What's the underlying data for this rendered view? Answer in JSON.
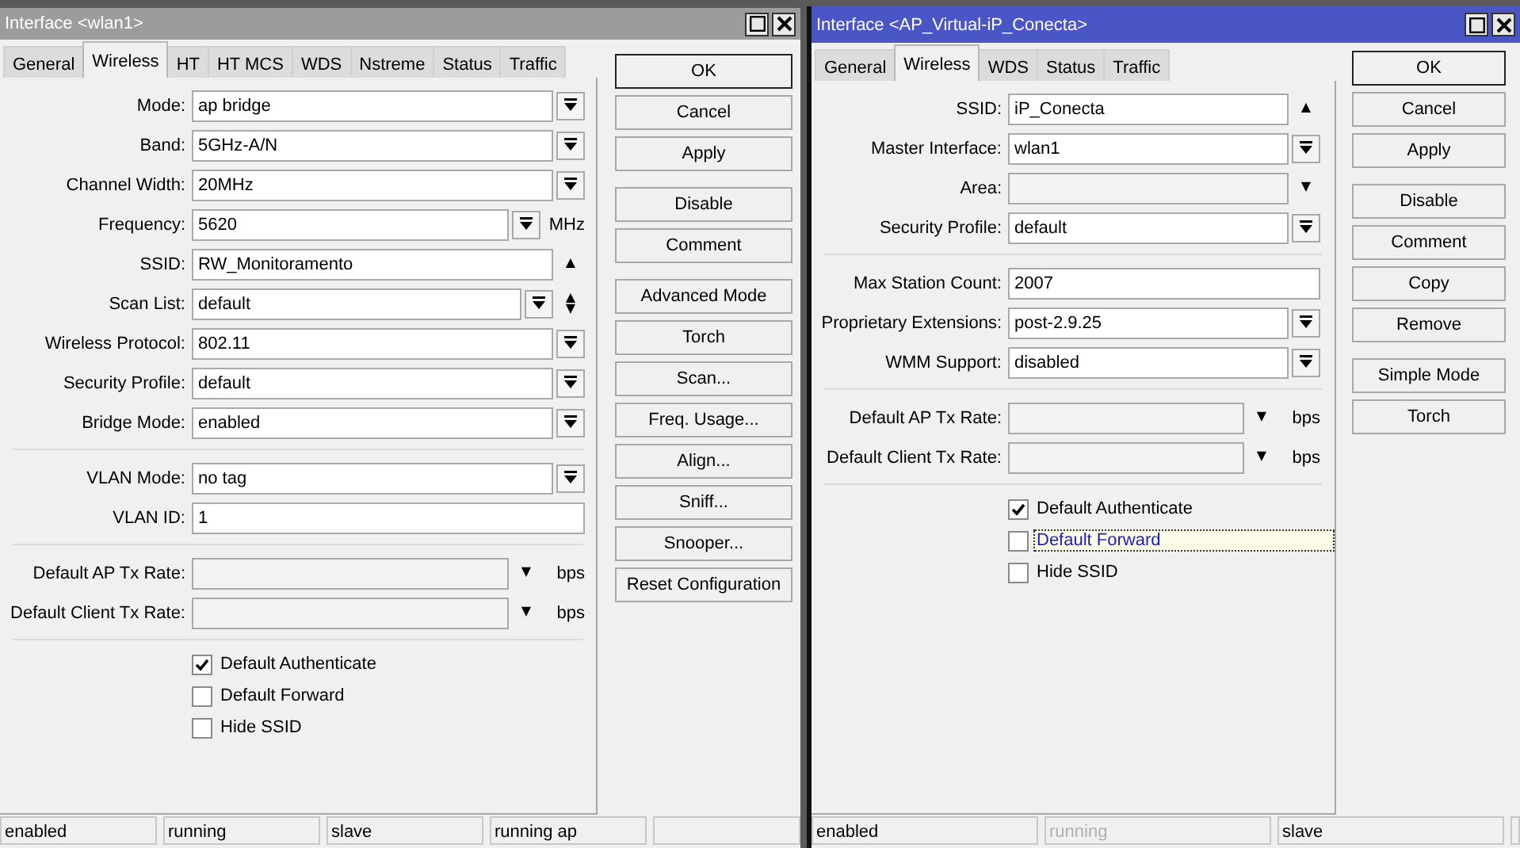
{
  "windows": [
    {
      "title": "Interface <wlan1>",
      "active": false,
      "tabs": [
        {
          "label": "General",
          "selected": false
        },
        {
          "label": "Wireless",
          "selected": true
        },
        {
          "label": "HT",
          "selected": false
        },
        {
          "label": "HT MCS",
          "selected": false
        },
        {
          "label": "WDS",
          "selected": false
        },
        {
          "label": "Nstreme",
          "selected": false
        },
        {
          "label": "Status",
          "selected": false
        },
        {
          "label": "Traffic",
          "selected": false
        }
      ],
      "rows": [
        {
          "kind": "field",
          "label": "Mode:",
          "value": "ap bridge",
          "dropdown": true
        },
        {
          "kind": "field",
          "label": "Band:",
          "value": "5GHz-A/N",
          "dropdown": true
        },
        {
          "kind": "field",
          "label": "Channel Width:",
          "value": "20MHz",
          "dropdown": true
        },
        {
          "kind": "field",
          "label": "Frequency:",
          "value": "5620",
          "dropdown": true,
          "unit": "MHz"
        },
        {
          "kind": "field",
          "label": "SSID:",
          "value": "RW_Monitoramento",
          "arrow": "▲"
        },
        {
          "kind": "field",
          "label": "Scan List:",
          "value": "default",
          "dropdown": true,
          "arrow": "▲▼"
        },
        {
          "kind": "field",
          "label": "Wireless Protocol:",
          "value": "802.11",
          "dropdown": true
        },
        {
          "kind": "field",
          "label": "Security Profile:",
          "value": "default",
          "dropdown": true
        },
        {
          "kind": "field",
          "label": "Bridge Mode:",
          "value": "enabled",
          "dropdown": true
        },
        {
          "kind": "separator"
        },
        {
          "kind": "field",
          "label": "VLAN Mode:",
          "value": "no tag",
          "dropdown": true
        },
        {
          "kind": "field",
          "label": "VLAN ID:",
          "value": "1"
        },
        {
          "kind": "separator"
        },
        {
          "kind": "field",
          "label": "Default AP Tx Rate:",
          "disabled": true,
          "arrow": "▼",
          "unit": "bps"
        },
        {
          "kind": "field",
          "label": "Default Client Tx Rate:",
          "disabled": true,
          "arrow": "▼",
          "unit": "bps"
        },
        {
          "kind": "separator"
        },
        {
          "kind": "checkbox",
          "label": "Default Authenticate",
          "checked": true,
          "focused": false
        },
        {
          "kind": "checkbox",
          "label": "Default Forward",
          "checked": false,
          "focused": false
        },
        {
          "kind": "checkbox",
          "label": "Hide SSID",
          "checked": false,
          "focused": false
        }
      ],
      "button_groups": [
        [
          {
            "label": "OK",
            "default": true
          },
          {
            "label": "Cancel",
            "default": false
          },
          {
            "label": "Apply",
            "default": false
          }
        ],
        [
          {
            "label": "Disable",
            "default": false
          },
          {
            "label": "Comment",
            "default": false
          }
        ],
        [
          {
            "label": "Advanced Mode",
            "default": false
          },
          {
            "label": "Torch",
            "default": false
          },
          {
            "label": "Scan...",
            "default": false
          },
          {
            "label": "Freq. Usage...",
            "default": false
          },
          {
            "label": "Align...",
            "default": false
          },
          {
            "label": "Sniff...",
            "default": false
          },
          {
            "label": "Snooper...",
            "default": false
          },
          {
            "label": "Reset Configuration",
            "default": false
          }
        ]
      ],
      "status": [
        {
          "text": "enabled",
          "dimmed": false
        },
        {
          "text": "running",
          "dimmed": false
        },
        {
          "text": "slave",
          "dimmed": false
        },
        {
          "text": "running ap",
          "dimmed": false
        }
      ]
    },
    {
      "title": "Interface <AP_Virtual-iP_Conecta>",
      "active": true,
      "tabs": [
        {
          "label": "General",
          "selected": false
        },
        {
          "label": "Wireless",
          "selected": true
        },
        {
          "label": "WDS",
          "selected": false
        },
        {
          "label": "Status",
          "selected": false
        },
        {
          "label": "Traffic",
          "selected": false
        }
      ],
      "rows": [
        {
          "kind": "field",
          "label": "SSID:",
          "value": "iP_Conecta",
          "arrow": "▲"
        },
        {
          "kind": "field",
          "label": "Master Interface:",
          "value": "wlan1",
          "dropdown": true
        },
        {
          "kind": "field",
          "label": "Area:",
          "disabled": true,
          "arrow": "▼"
        },
        {
          "kind": "field",
          "label": "Security Profile:",
          "value": "default",
          "dropdown": true
        },
        {
          "kind": "separator"
        },
        {
          "kind": "field",
          "label": "Max Station Count:",
          "value": "2007"
        },
        {
          "kind": "field",
          "label": "Proprietary Extensions:",
          "value": "post-2.9.25",
          "dropdown": true
        },
        {
          "kind": "field",
          "label": "WMM Support:",
          "value": "disabled",
          "dropdown": true
        },
        {
          "kind": "separator"
        },
        {
          "kind": "field",
          "label": "Default AP Tx Rate:",
          "disabled": true,
          "arrow": "▼",
          "unit": "bps"
        },
        {
          "kind": "field",
          "label": "Default Client Tx Rate:",
          "disabled": true,
          "arrow": "▼",
          "unit": "bps"
        },
        {
          "kind": "separator"
        },
        {
          "kind": "checkbox",
          "label": "Default Authenticate",
          "checked": true,
          "focused": false
        },
        {
          "kind": "checkbox",
          "label": "Default Forward",
          "checked": false,
          "focused": true
        },
        {
          "kind": "checkbox",
          "label": "Hide SSID",
          "checked": false,
          "focused": false
        }
      ],
      "button_groups": [
        [
          {
            "label": "OK",
            "default": true
          },
          {
            "label": "Cancel",
            "default": false
          },
          {
            "label": "Apply",
            "default": false
          }
        ],
        [
          {
            "label": "Disable",
            "default": false
          },
          {
            "label": "Comment",
            "default": false
          },
          {
            "label": "Copy",
            "default": false
          },
          {
            "label": "Remove",
            "default": false
          }
        ],
        [
          {
            "label": "Simple Mode",
            "default": false
          },
          {
            "label": "Torch",
            "default": false
          }
        ]
      ],
      "status": [
        {
          "text": "enabled",
          "dimmed": false
        },
        {
          "text": "running",
          "dimmed": true
        },
        {
          "text": "slave",
          "dimmed": false
        }
      ]
    }
  ]
}
